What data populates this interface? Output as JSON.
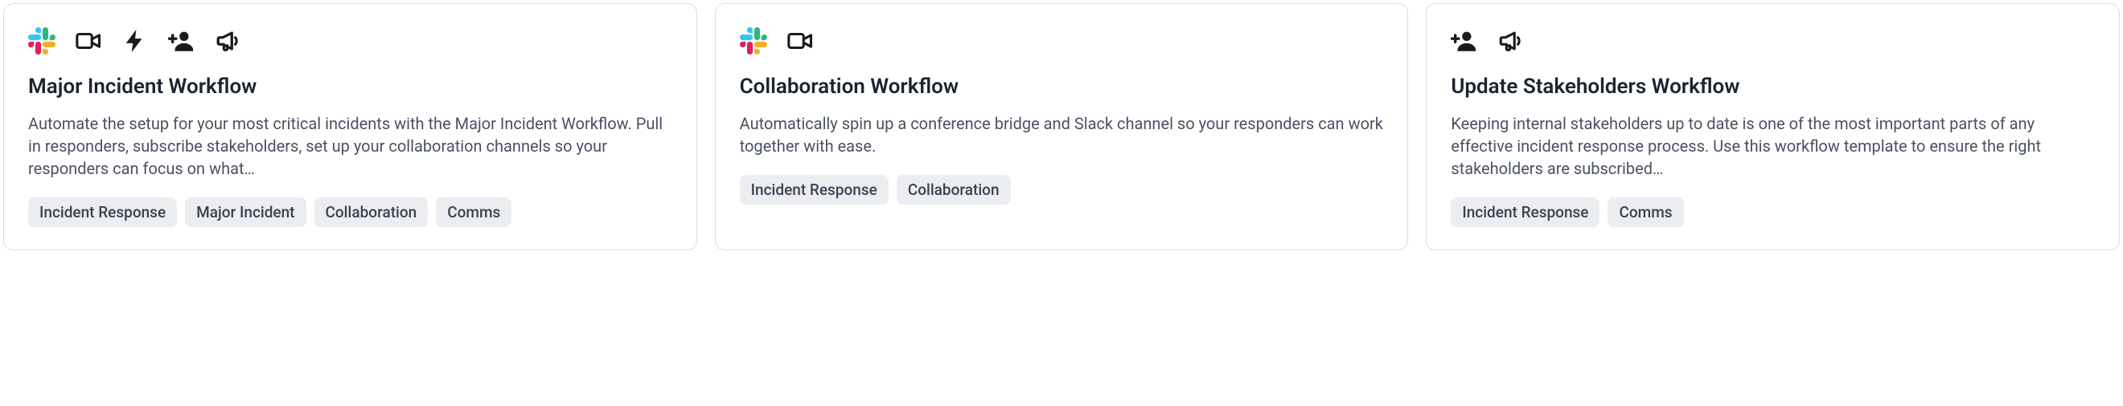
{
  "cards": [
    {
      "icons": [
        "slack-icon",
        "video-icon",
        "bolt-icon",
        "add-user-icon",
        "megaphone-icon"
      ],
      "title": "Major Incident Workflow",
      "description": "Automate the setup for your most critical incidents with the Major Incident Workflow. Pull in responders, subscribe stakeholders, set up your collaboration channels so your responders can focus on what…",
      "tags": [
        "Incident Response",
        "Major Incident",
        "Collaboration",
        "Comms"
      ]
    },
    {
      "icons": [
        "slack-icon",
        "video-icon"
      ],
      "title": "Collaboration Workflow",
      "description": "Automatically spin up a conference bridge and Slack channel so your responders can work together with ease.",
      "tags": [
        "Incident Response",
        "Collaboration"
      ]
    },
    {
      "icons": [
        "add-user-icon",
        "megaphone-icon"
      ],
      "title": "Update Stakeholders Workflow",
      "description": "Keeping internal stakeholders up to date is one of the most important parts of any effective incident response process. Use this workflow template to ensure the right stakeholders are subscribed…",
      "tags": [
        "Incident Response",
        "Comms"
      ]
    }
  ]
}
